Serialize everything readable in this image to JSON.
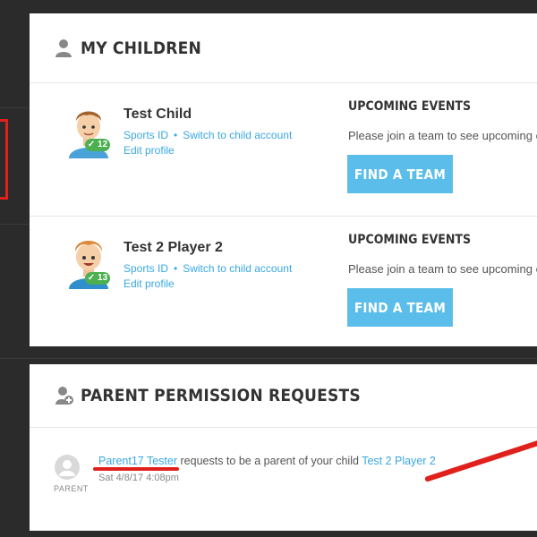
{
  "my_children": {
    "title": "MY CHILDREN",
    "children": [
      {
        "name": "Test Child",
        "age_badge": "12",
        "sports_id_label": "Sports ID",
        "switch_label": "Switch to child account",
        "edit_label": "Edit profile",
        "upcoming_title": "UPCOMING EVENTS",
        "upcoming_text": "Please join a team to see upcoming e",
        "find_team_label": "FIND A TEAM"
      },
      {
        "name": "Test 2 Player 2",
        "age_badge": "13",
        "sports_id_label": "Sports ID",
        "switch_label": "Switch to child account",
        "edit_label": "Edit profile",
        "upcoming_title": "UPCOMING EVENTS",
        "upcoming_text": "Please join a team to see upcoming e",
        "find_team_label": "FIND A TEAM"
      }
    ]
  },
  "parent_requests": {
    "title": "PARENT PERMISSION REQUESTS",
    "request": {
      "avatar_label": "PARENT",
      "requester": "Parent17 Tester",
      "message": "requests to be a parent of your child",
      "child": "Test 2 Player 2",
      "timestamp": "Sat 4/8/17 4:08pm"
    }
  },
  "colors": {
    "accent": "#3aa8e0",
    "button": "#5bbde9",
    "badge": "#4caf50",
    "annotation": "#e0201b"
  }
}
